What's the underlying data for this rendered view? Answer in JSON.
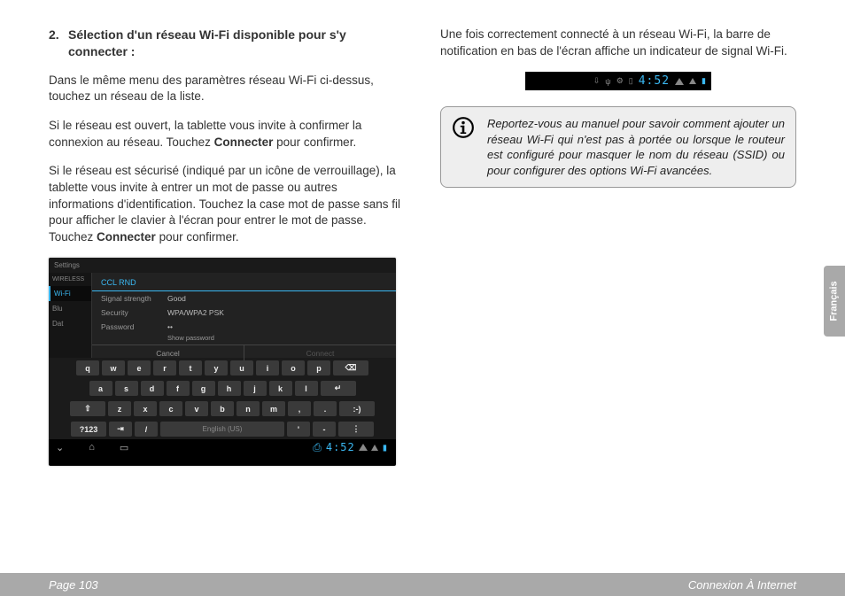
{
  "col1": {
    "heading_num": "2.",
    "heading": "Sélection d'un réseau Wi-Fi disponible pour s'y connecter :",
    "p1": "Dans le même menu des paramètres réseau Wi-Fi ci-dessus, touchez un réseau de la liste.",
    "p2a": "Si le réseau est ouvert, la tablette vous invite à confirmer la connexion au réseau. Touchez ",
    "p2b": "Connecter",
    "p2c": " pour confirmer.",
    "p3a": "Si le réseau est sécurisé (indiqué par un icône de verrouillage), la tablette vous invite à entrer un mot de passe ou autres informations d'identification. Touchez la case mot de passe sans fil pour afficher le clavier à l'écran pour entrer le mot de passe. Touchez ",
    "p3b": "Connecter",
    "p3c": " pour confirmer."
  },
  "col2": {
    "p1": "Une fois correctement connecté à un réseau Wi-Fi, la barre de notification en bas de l'écran affiche un indicateur de signal Wi-Fi.",
    "info": "Reportez-vous au manuel pour savoir comment ajouter un réseau Wi-Fi qui n'est pas à portée ou lorsque le routeur est configuré pour masquer le nom du réseau (SSID) ou pour configurer des options Wi-Fi avancées."
  },
  "screenshot": {
    "top": "Settings",
    "side_hdr": "WIRELESS",
    "side_wifi": "Wi-Fi",
    "side_blu": "Blu",
    "side_data": "Dat",
    "dlg_title": "CCL RND",
    "row_strength_l": "Signal strength",
    "row_strength_v": "Good",
    "row_sec_l": "Security",
    "row_sec_v": "WPA/WPA2 PSK",
    "row_pw_l": "Password",
    "row_pw_v": "••",
    "show_pw": "Show password",
    "cancel": "Cancel",
    "connect": "Connect",
    "space": "English (US)",
    "sym": "?123",
    "clock": "4:52",
    "keys": {
      "r1": [
        "q",
        "w",
        "e",
        "r",
        "t",
        "y",
        "u",
        "i",
        "o",
        "p",
        "⌫"
      ],
      "r2": [
        "a",
        "s",
        "d",
        "f",
        "g",
        "h",
        "j",
        "k",
        "l",
        "↵"
      ],
      "r3": [
        "⇧",
        "z",
        "x",
        "c",
        "v",
        "b",
        "n",
        "m",
        ",",
        ".",
        ":-)"
      ],
      "r4_left": "⇥",
      "r4_slash": "/",
      "r4_apos": "'",
      "r4_dash": "-"
    }
  },
  "statusbar": {
    "clock": "4:52"
  },
  "sidetab": "Français",
  "footer": {
    "left": "Page 103",
    "right": "Connexion À Internet"
  }
}
